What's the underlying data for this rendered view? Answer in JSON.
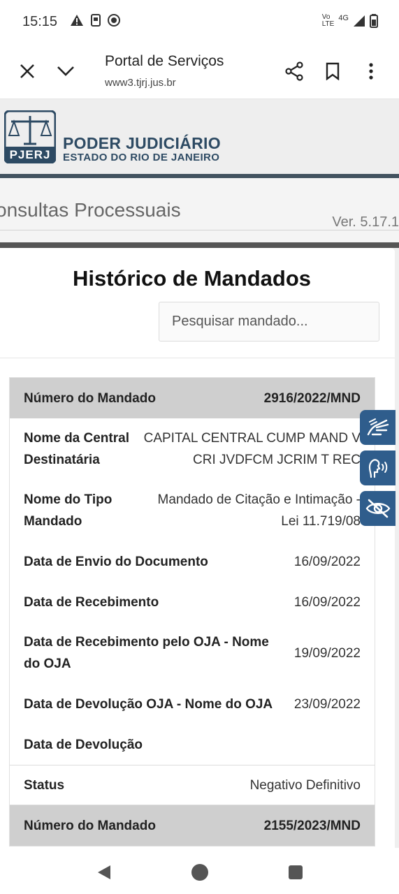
{
  "status_bar": {
    "time": "15:15",
    "left_icons": [
      "alert-icon",
      "sim-icon",
      "target-icon"
    ],
    "network_top": "Vo",
    "network_bottom": "LTE",
    "network_gen": "4G",
    "right_icons": [
      "signal-icon",
      "battery-icon"
    ]
  },
  "browser": {
    "title": "Portal de Serviços",
    "url": "www3.tjrj.jus.br",
    "icons": [
      "close-icon",
      "chevron-down-icon",
      "share-icon",
      "bookmark-icon",
      "more-vert-icon"
    ]
  },
  "site": {
    "logo_text": "PJERJ",
    "org_name": "PODER JUDICIÁRIO",
    "org_sub": "ESTADO DO RIO DE JANEIRO",
    "section_title": "onsultas Processuais",
    "version": "Ver. 5.17.1",
    "brand_color": "#2d4a63"
  },
  "modal": {
    "title": "Histórico de Mandados",
    "search_placeholder": "Pesquisar mandado...",
    "records": [
      {
        "numero_label": "Número do Mandado",
        "numero": "2916/2022/MND",
        "central_label_1": "Nome da Central",
        "central_label_2": "Destinatária",
        "central_1": "CAPITAL CENTRAL CUMP MAND V",
        "central_2": "CRI JVDFCM JCRIM T REC",
        "tipo_label_1": "Nome do Tipo",
        "tipo_label_2": "Mandado",
        "tipo_1": "Mandado de Citação e Intimação -",
        "tipo_2": "Lei 11.719/08",
        "envio_label": "Data de Envio do Documento",
        "envio": "16/09/2022",
        "receb_label": "Data de Recebimento",
        "receb": "16/09/2022",
        "receb_oja_label_1": "Data de Recebimento pelo OJA - Nome",
        "receb_oja_label_2": "do OJA",
        "receb_oja": "19/09/2022",
        "devol_oja_label": "Data de Devolução OJA - Nome do OJA",
        "devol_oja": "23/09/2022",
        "devol_label": "Data de Devolução",
        "status_label": "Status",
        "status": "Negativo Definitivo"
      },
      {
        "numero_label": "Número do Mandado",
        "numero": "2155/2023/MND"
      }
    ]
  },
  "accessibility": {
    "icons": [
      "sign-language-icon",
      "audio-description-icon",
      "low-vision-icon"
    ],
    "color": "#2f5d8c"
  },
  "navbar": {
    "icons": [
      "back-icon",
      "home-icon",
      "recents-icon"
    ]
  }
}
